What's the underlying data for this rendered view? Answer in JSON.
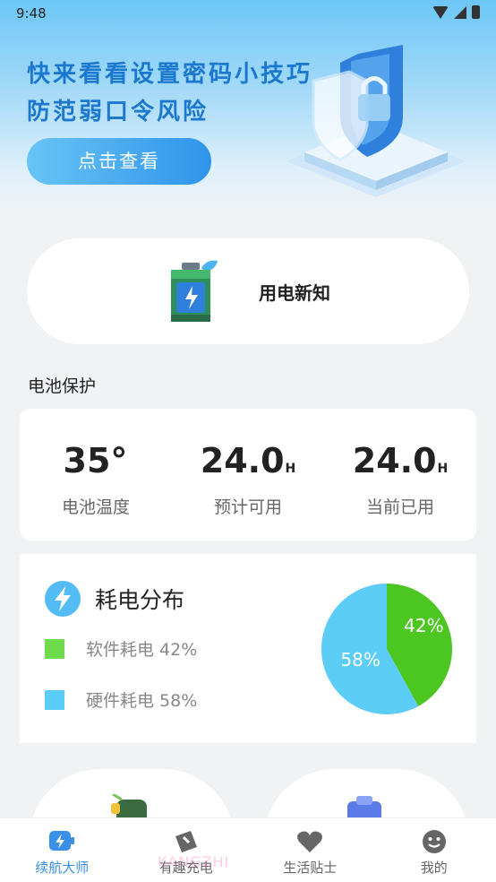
{
  "status_bar": {
    "time": "9:48"
  },
  "hero": {
    "line1": "快来看看设置密码小技巧",
    "line2": "防范弱口令风险",
    "button_label": "点击查看"
  },
  "notice": {
    "label": "用电新知"
  },
  "battery_protection": {
    "section_title": "电池保护",
    "stats": [
      {
        "value": "35°",
        "unit": "",
        "label": "电池温度"
      },
      {
        "value": "24.0",
        "unit": "H",
        "label": "预计可用"
      },
      {
        "value": "24.0",
        "unit": "H",
        "label": "当前已用"
      }
    ]
  },
  "distribution": {
    "title": "耗电分布",
    "legend": [
      {
        "label": "软件耗电 42%",
        "color": "#6ddb4a"
      },
      {
        "label": "硬件耗电 58%",
        "color": "#5ccdf7"
      }
    ]
  },
  "chart_data": {
    "type": "pie",
    "series": [
      {
        "name": "软件耗电",
        "value": 42,
        "label": "42%",
        "color": "#4cc620"
      },
      {
        "name": "硬件耗电",
        "value": 58,
        "label": "58%",
        "color": "#5ccdf7"
      }
    ]
  },
  "tabbar": {
    "tabs": [
      {
        "label": "续航大师",
        "active": true
      },
      {
        "label": "有趣充电",
        "active": false
      },
      {
        "label": "生活贴士",
        "active": false
      },
      {
        "label": "我的",
        "active": false
      }
    ]
  },
  "watermark": "KANGZHI"
}
